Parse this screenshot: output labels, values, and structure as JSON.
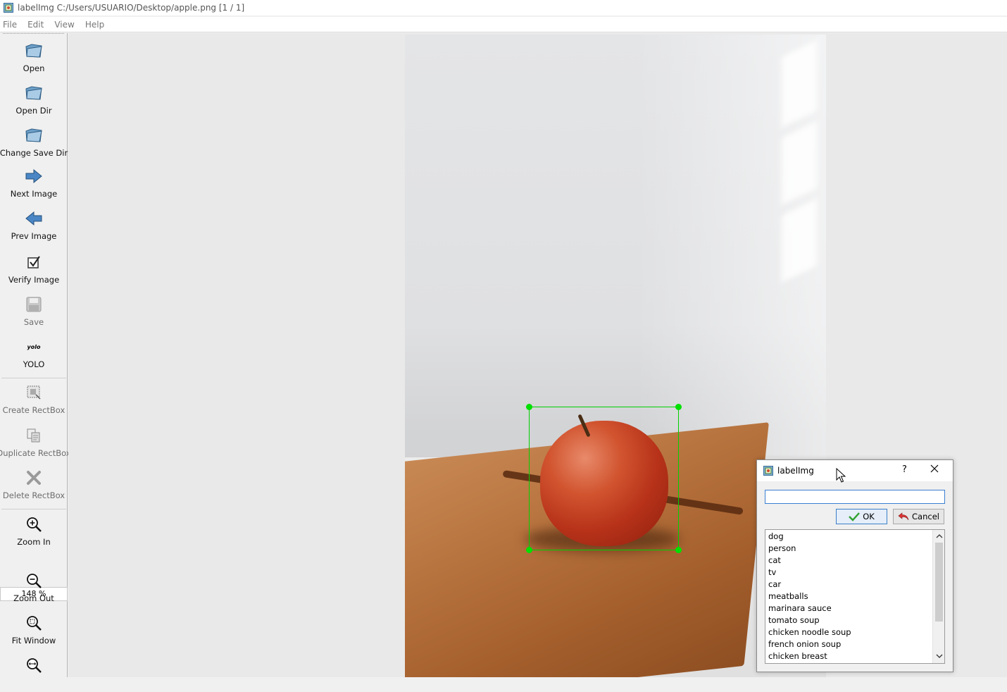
{
  "window": {
    "title": "labelImg C:/Users/USUARIO/Desktop/apple.png [1 / 1]",
    "app_icon": "labelimg-icon"
  },
  "menu": {
    "items": [
      "File",
      "Edit",
      "View",
      "Help"
    ]
  },
  "toolbar": {
    "open": "Open",
    "open_dir": "Open Dir",
    "change_save_dir": "Change Save Dir",
    "next_image": "Next Image",
    "prev_image": "Prev Image",
    "verify_image": "Verify Image",
    "save": "Save",
    "yolo_icon_text": "yolo",
    "yolo": "YOLO",
    "create_rectbox": "Create RectBox",
    "duplicate_rectbox": "Duplicate RectBox",
    "delete_rectbox": "Delete RectBox",
    "zoom_in": "Zoom In",
    "zoom_value": "148 %",
    "zoom_out": "Zoom Out",
    "fit_window": "Fit Window"
  },
  "dialog": {
    "title": "labelImg",
    "help": "?",
    "input_value": "",
    "ok": "OK",
    "cancel": "Cancel",
    "labels": [
      "dog",
      "person",
      "cat",
      "tv",
      "car",
      "meatballs",
      "marinara sauce",
      "tomato soup",
      "chicken noodle soup",
      "french onion soup",
      "chicken breast"
    ]
  },
  "colors": {
    "bbox": "#00d000",
    "accent": "#3b7fd0"
  }
}
